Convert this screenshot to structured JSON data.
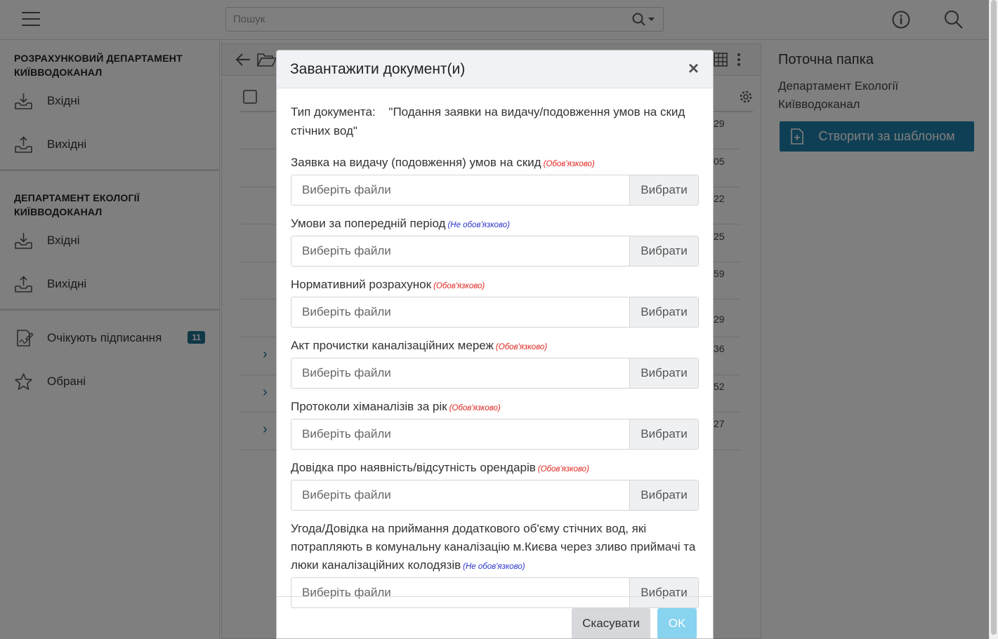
{
  "topbar": {
    "search_placeholder": "Пошук"
  },
  "sidebar": {
    "sections": [
      {
        "title": "Розрахунковий департамент Київводоканал",
        "items": [
          {
            "label": "Вхідні",
            "icon": "inbox-icon"
          },
          {
            "label": "Вихідні",
            "icon": "outbox-icon"
          }
        ]
      },
      {
        "title": "Департамент екології Київводоканал",
        "items": [
          {
            "label": "Вхідні",
            "icon": "inbox-icon"
          },
          {
            "label": "Вихідні",
            "icon": "outbox-icon"
          }
        ]
      }
    ],
    "awaiting": {
      "label": "Очікують підписання",
      "count": "11",
      "icon": "sign-document-icon"
    },
    "favorites": {
      "label": "Обрані",
      "icon": "star-icon"
    }
  },
  "list": {
    "row_numbers": [
      "29",
      "05",
      "22",
      "25",
      "59",
      "29",
      "36",
      "52",
      "27"
    ]
  },
  "right_panel": {
    "title": "Поточна папка",
    "folder": "Департамент Екології Київводоканал",
    "create_button": "Створити за шаблоном"
  },
  "modal": {
    "title": "Завантажити документ(и)",
    "close": "×",
    "doc_type_label": "Тип документа:",
    "doc_type_value": "\"Подання заявки на видачу/подовження умов на скид стічних вод\"",
    "file_placeholder": "Виберіть файли",
    "browse_label": "Вибрати",
    "fields": [
      {
        "label": "Заявка на видачу (подовження) умов на скид",
        "note": "(Обов'язково)"
      },
      {
        "label": "Умови за попередній період",
        "note": "(Не обов'язково)"
      },
      {
        "label": "Нормативний розрахунок",
        "note": "(Обов'язково)"
      },
      {
        "label": "Акт прочистки каналізаційних мереж",
        "note": "(Обов'язково)"
      },
      {
        "label": "Протоколи хіманалізів за рік",
        "note": "(Обов'язково)"
      },
      {
        "label": "Довідка про наявність/відсутність орендарів",
        "note": "(Обов'язково)"
      },
      {
        "label": "Угода/Довідка на приймання додаткового об'єму стічних вод, які потрапляють в комунальну каналізацію м.Києва через зливо приймачі та люки каналізаційних колодязів",
        "note": "(Не обов'язково)"
      }
    ],
    "cancel_label": "Скасувати",
    "ok_label": "OK"
  },
  "colors": {
    "accent": "#1f7ea8",
    "required": "#e0261f",
    "optional": "#2a35c9",
    "ok_button": "#87d3f0"
  }
}
